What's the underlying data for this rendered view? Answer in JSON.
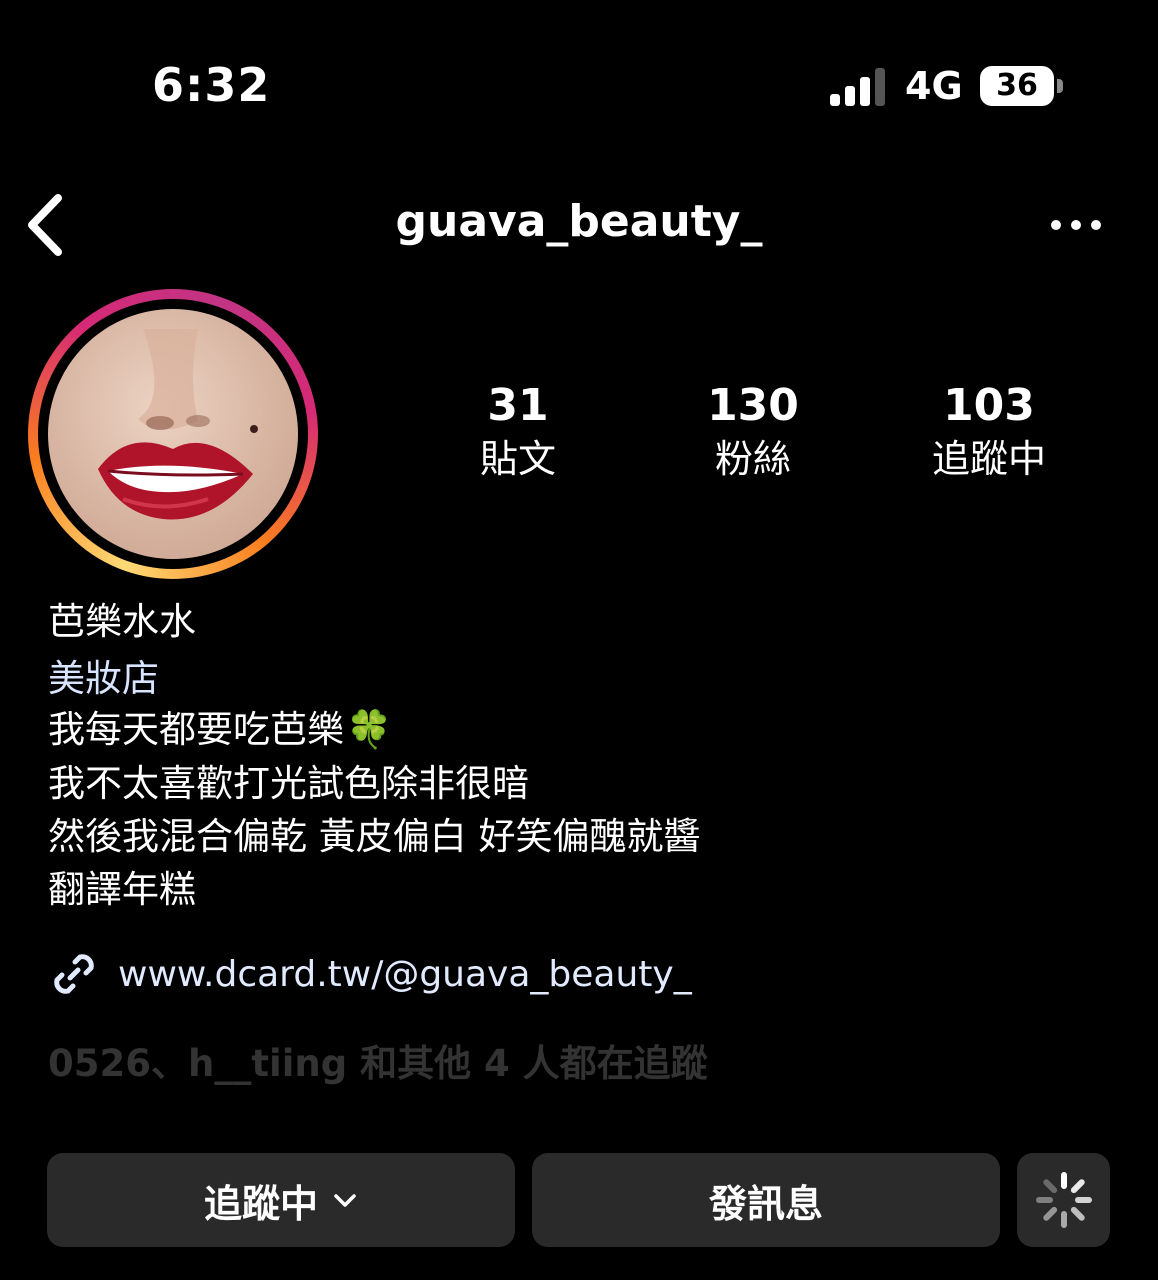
{
  "status_bar": {
    "time": "6:32",
    "network": "4G",
    "battery": "36"
  },
  "header": {
    "username": "guava_beauty_",
    "back_icon": "chevron-left-icon",
    "more_icon": "ellipsis-icon"
  },
  "stats": [
    {
      "value": "31",
      "label": "貼文"
    },
    {
      "value": "130",
      "label": "粉絲"
    },
    {
      "value": "103",
      "label": "追蹤中"
    }
  ],
  "bio": {
    "name": "芭樂水水",
    "category": "美妝店",
    "lines": [
      "我每天都要吃芭樂",
      "我不太喜歡打光試色除非很暗",
      "然後我混合偏乾 黃皮偏白 好笑偏醜就醬",
      "翻譯年糕"
    ],
    "emoji": "🍀"
  },
  "link": {
    "text": "www.dcard.tw/@guava_beauty_",
    "icon": "link-icon"
  },
  "followed_by": {
    "text": "0526、h__tiing 和其他 4 人都在追蹤"
  },
  "buttons": {
    "following": "追蹤中",
    "message": "發訊息",
    "suggest_icon": "loading-spinner-icon"
  },
  "colors": {
    "background": "#000000",
    "button": "#2a2a2a",
    "link": "#e2eaff"
  }
}
